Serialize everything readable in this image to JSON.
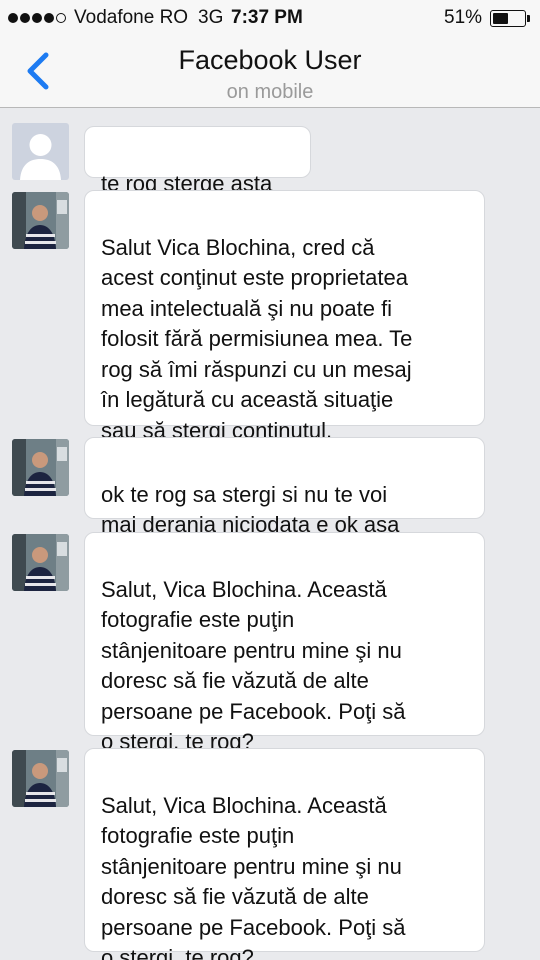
{
  "status_bar": {
    "carrier": "Vodafone RO",
    "network": "3G",
    "time": "7:37 PM",
    "battery": "51%",
    "battery_level": 0.51
  },
  "nav": {
    "title": "Facebook User",
    "subtitle": "on mobile"
  },
  "messages": [
    {
      "avatar": "default-avatar",
      "text": "te rog sterge asta"
    },
    {
      "avatar": "sender-photo",
      "text": "Salut Vica Blochina, cred că\nacest conţinut este proprietatea\nmea intelectuală şi nu poate fi\nfolosit fără permisiunea mea. Te\nrog să îmi răspunzi cu un mesaj\nîn legătură cu această situaţie\nsau să ştergi conţinutul."
    },
    {
      "avatar": "sender-photo",
      "text": "ok te rog sa stergi si nu te voi\nmai deranja niciodata e ok asa"
    },
    {
      "avatar": "sender-photo",
      "text": "Salut, Vica Blochina. Această\nfotografie este puţin\nstânjenitoare pentru mine şi nu\ndoresc să fie văzută de alte\npersoane pe Facebook. Poţi să\no ştergi, te rog?"
    },
    {
      "avatar": "sender-photo",
      "text": "Salut, Vica Blochina. Această\nfotografie este puţin\nstânjenitoare pentru mine şi nu\ndoresc să fie văzută de alte\npersoane pe Facebook. Poţi să\no ştergi, te rog?"
    }
  ],
  "colors": {
    "accent": "#1d7bf2",
    "background": "#e9eaed",
    "bubble": "#ffffff",
    "subtitle": "#9a9a9a"
  }
}
